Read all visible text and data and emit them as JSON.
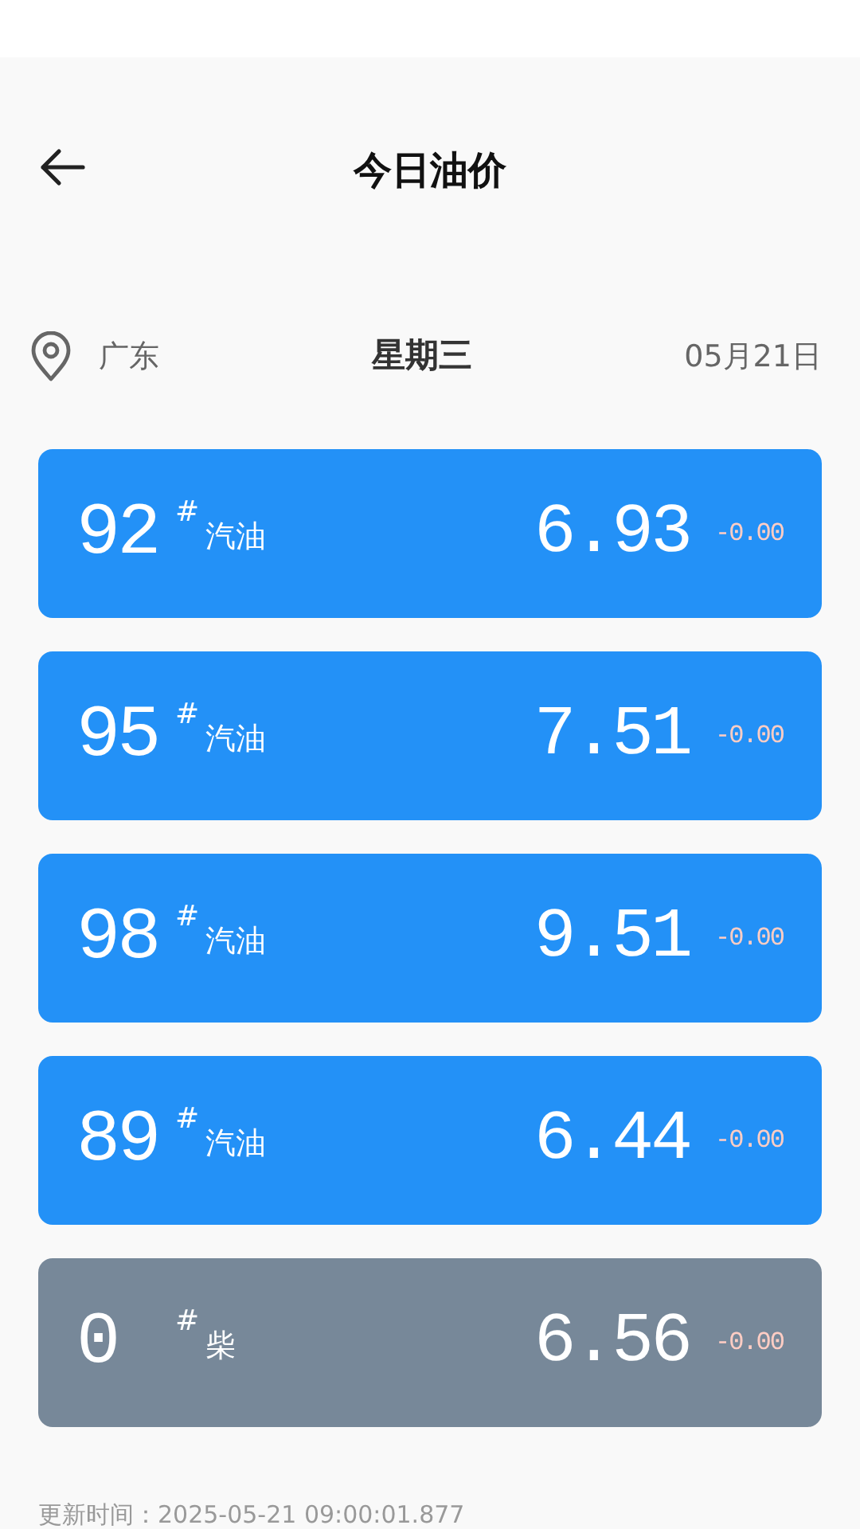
{
  "header": {
    "title": "今日油价"
  },
  "info": {
    "province": "广东",
    "weekday": "星期三",
    "date": "05月21日"
  },
  "prices": [
    {
      "grade": "92",
      "mark": "#",
      "fuel": "汽油",
      "price": "6.93",
      "change": "-0.00",
      "color": "#2391f7"
    },
    {
      "grade": "95",
      "mark": "#",
      "fuel": "汽油",
      "price": "7.51",
      "change": "-0.00",
      "color": "#2391f7"
    },
    {
      "grade": "98",
      "mark": "#",
      "fuel": "汽油",
      "price": "9.51",
      "change": "-0.00",
      "color": "#2391f7"
    },
    {
      "grade": "89",
      "mark": "#",
      "fuel": "汽油",
      "price": "6.44",
      "change": "-0.00",
      "color": "#2391f7"
    },
    {
      "grade": "0",
      "mark": "#",
      "fuel": "柴",
      "price": "6.56",
      "change": "-0.00",
      "color": "#778899"
    }
  ],
  "footer": {
    "updated": "更新时间：2025-05-21 09:00:01.877"
  }
}
